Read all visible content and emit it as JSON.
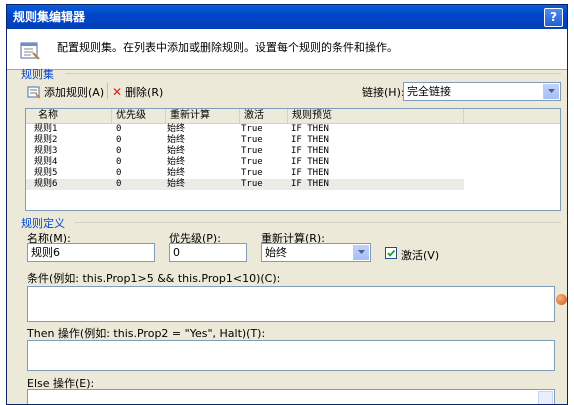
{
  "window": {
    "title": "规则集编辑器",
    "help": "?"
  },
  "header": {
    "description": "配置规则集。在列表中添加或删除规则。设置每个规则的条件和操作。"
  },
  "ruleset": {
    "group_label": "规则集",
    "add_label": "添加规则(A)",
    "delete_label": "删除(R)",
    "chaining_label": "链接(H):",
    "chaining_value": "完全链接",
    "columns": [
      "名称",
      "优先级",
      "重新计算",
      "激活",
      "规则预览"
    ],
    "rows": [
      {
        "name": "规则1",
        "priority": "0",
        "reeval": "始终",
        "active": "True",
        "preview": "IF THEN"
      },
      {
        "name": "规则2",
        "priority": "0",
        "reeval": "始终",
        "active": "True",
        "preview": "IF THEN"
      },
      {
        "name": "规则3",
        "priority": "0",
        "reeval": "始终",
        "active": "True",
        "preview": "IF THEN"
      },
      {
        "name": "规则4",
        "priority": "0",
        "reeval": "始终",
        "active": "True",
        "preview": "IF THEN"
      },
      {
        "name": "规则5",
        "priority": "0",
        "reeval": "始终",
        "active": "True",
        "preview": "IF THEN"
      },
      {
        "name": "规则6",
        "priority": "0",
        "reeval": "始终",
        "active": "True",
        "preview": "IF THEN"
      }
    ]
  },
  "definition": {
    "group_label": "规则定义",
    "name_label": "名称(M):",
    "name_value": "规则6",
    "priority_label": "优先级(P):",
    "priority_value": "0",
    "reeval_label": "重新计算(R):",
    "reeval_value": "始终",
    "active_label": "激活(V)",
    "active_checked": true,
    "condition_label": "条件(例如: this.Prop1>5 && this.Prop1<10)(C):",
    "then_label": "Then 操作(例如: this.Prop2 = \"Yes\", Halt)(T):",
    "else_label": "Else 操作(E):"
  },
  "colors": {
    "accent": "#0046D5",
    "title_bar": "#0046C8",
    "dialog_bg": "#ECE9D8"
  }
}
